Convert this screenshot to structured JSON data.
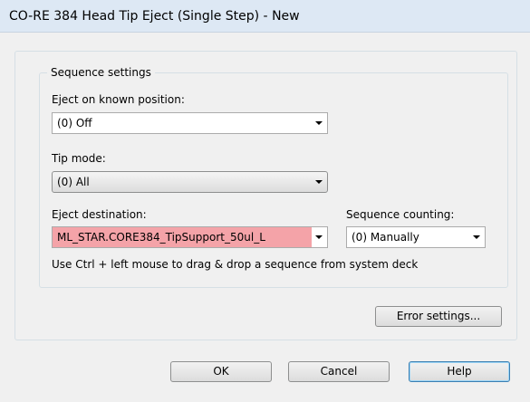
{
  "window": {
    "title": "CO-RE 384 Head Tip Eject (Single Step) - New"
  },
  "sequence_settings": {
    "legend": "Sequence settings",
    "eject_known_position": {
      "label": "Eject on known position:",
      "value": "(0) Off"
    },
    "tip_mode": {
      "label": "Tip mode:",
      "value": "(0) All"
    },
    "eject_destination": {
      "label": "Eject destination:",
      "value": "ML_STAR.CORE384_TipSupport_50ul_L",
      "status_color": "#f4a3a8"
    },
    "sequence_counting": {
      "label": "Sequence counting:",
      "value": "(0) Manually"
    },
    "hint": "Use Ctrl + left mouse to drag & drop a sequence from system deck"
  },
  "buttons": {
    "error_settings": "Error settings...",
    "ok": "OK",
    "cancel": "Cancel",
    "help": "Help"
  }
}
